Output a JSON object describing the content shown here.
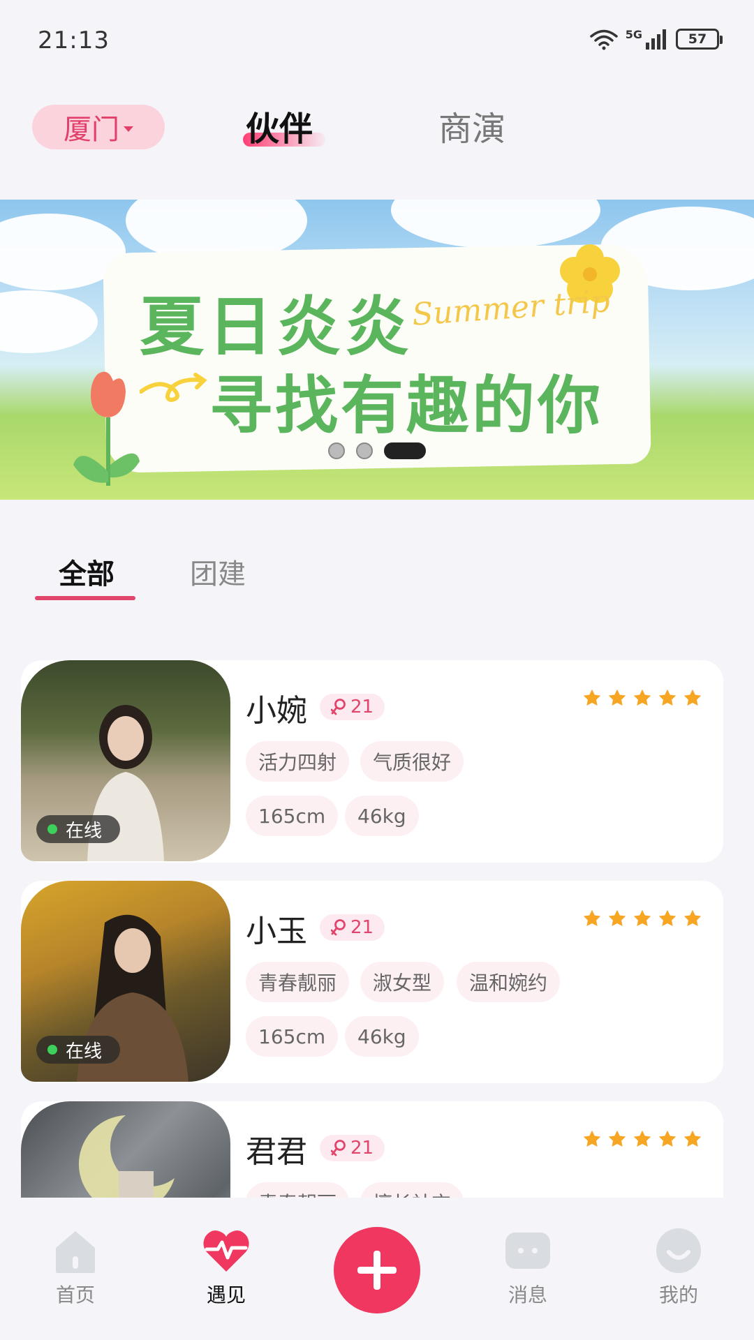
{
  "status_bar": {
    "time": "21:13",
    "network": "5G",
    "battery": "57"
  },
  "header": {
    "city": "厦门",
    "tabs": [
      {
        "label": "伙伴",
        "active": true
      },
      {
        "label": "商演",
        "active": false
      }
    ]
  },
  "banner": {
    "line1": "夏日炎炎",
    "script": "Summer trip",
    "line2": "寻找有趣的你",
    "dots": 3,
    "active_dot": 3
  },
  "sub_tabs": [
    {
      "label": "全部",
      "active": true
    },
    {
      "label": "团建",
      "active": false
    }
  ],
  "companions": [
    {
      "name": "小婉",
      "age": "21",
      "rating": 5,
      "online": "在线",
      "tags": [
        "活力四射",
        "气质很好"
      ],
      "height": "165cm",
      "weight": "46kg"
    },
    {
      "name": "小玉",
      "age": "21",
      "rating": 5,
      "online": "在线",
      "tags": [
        "青春靓丽",
        "淑女型",
        "温和婉约"
      ],
      "height": "165cm",
      "weight": "46kg"
    },
    {
      "name": "君君",
      "age": "21",
      "rating": 5,
      "online": "",
      "tags": [
        "青春靓丽",
        "擅长社交"
      ],
      "height": "",
      "weight": ""
    }
  ],
  "bottom_nav": [
    {
      "label": "首页",
      "icon": "home-icon",
      "active": false
    },
    {
      "label": "遇见",
      "icon": "heart-pulse-icon",
      "active": true
    },
    {
      "label": "",
      "icon": "plus-icon",
      "active": false
    },
    {
      "label": "消息",
      "icon": "message-icon",
      "active": false
    },
    {
      "label": "我的",
      "icon": "profile-icon",
      "active": false
    }
  ],
  "colors": {
    "accent": "#e2456c",
    "plus": "#f0375f",
    "star": "#f6a623",
    "online": "#3dd15b"
  }
}
